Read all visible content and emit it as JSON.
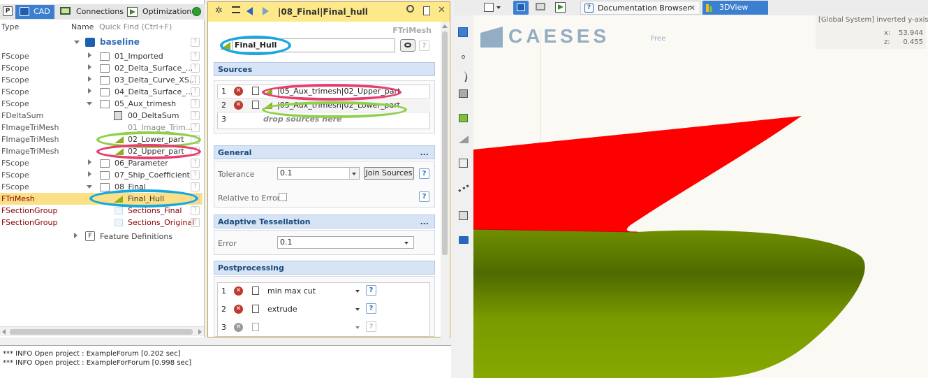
{
  "left": {
    "tabs": [
      {
        "label": "CAD"
      },
      {
        "label": "Connections"
      },
      {
        "label": "Optimization"
      }
    ],
    "columns": {
      "type": "Type",
      "name": "Name",
      "quick_find": "Quick Find (Ctrl+F)"
    },
    "root": "baseline",
    "rows": [
      {
        "type": "FScope",
        "name": "01_Imported"
      },
      {
        "type": "FScope",
        "name": "02_Delta_Surface_..."
      },
      {
        "type": "FScope",
        "name": "03_Delta_Curve_XS..."
      },
      {
        "type": "FScope",
        "name": "04_Delta_Surface_..."
      },
      {
        "type": "FScope",
        "name": "05_Aux_trimesh"
      },
      {
        "type": "FDeltaSum",
        "name": "00_DeltaSum"
      },
      {
        "type": "FImageTriMesh",
        "name": "01_Image_Trim..."
      },
      {
        "type": "FImageTriMesh",
        "name": "02_Lower_part"
      },
      {
        "type": "FImageTriMesh",
        "name": "02_Upper_part"
      },
      {
        "type": "FScope",
        "name": "06_Parameter"
      },
      {
        "type": "FScope",
        "name": "07_Ship_Coefficient"
      },
      {
        "type": "FScope",
        "name": "08_Final"
      },
      {
        "type": "FTriMesh",
        "name": "Final_Hull"
      },
      {
        "type": "FSectionGroup",
        "name": "Sections_Final"
      },
      {
        "type": "FSectionGroup",
        "name": "Sections_Original"
      }
    ],
    "feature_definitions": "Feature Definitions"
  },
  "mid": {
    "path": "|08_Final|Final_hull",
    "type_label": "FTriMesh",
    "name_value": "Final_Hull",
    "sections": {
      "sources": "Sources",
      "general": "General",
      "adaptive": "Adaptive Tessellation",
      "post": "Postprocessing"
    },
    "sources": [
      {
        "num": "1",
        "value": "|05_Aux_trimesh|02_Upper_part"
      },
      {
        "num": "2",
        "value": "|05_Aux_trimesh|02_Lower_part"
      },
      {
        "num": "3",
        "value": "drop sources here"
      }
    ],
    "general": {
      "tolerance_label": "Tolerance",
      "tolerance_value": "0.1",
      "join_label": "Join Sources",
      "relative_label": "Relative to Error"
    },
    "adaptive": {
      "error_label": "Error",
      "error_value": "0.1"
    },
    "post": [
      {
        "num": "1",
        "value": "min max cut"
      },
      {
        "num": "2",
        "value": "extrude"
      },
      {
        "num": "3",
        "value": ""
      }
    ],
    "more": "...",
    "help": "?"
  },
  "log": {
    "lines": [
      "*** INFO Open project : ExampleForum [0.202 sec]",
      "*** INFO Open project : ExampleForForum [0.998 sec]"
    ]
  },
  "right": {
    "tabs": [
      {
        "label": "Documentation Browser"
      },
      {
        "label": "3DView"
      }
    ],
    "close": "✕",
    "logo": "CAESES",
    "logo_sub": "Free",
    "coord_system": "[Global System] inverted y-axis",
    "x_label": "x:",
    "x_value": "53.944",
    "z_label": "z:",
    "z_value": "0.455",
    "colors": {
      "upper": "#ff0000",
      "lower": "#7a9a00",
      "bg": "#fbf9f4"
    }
  }
}
